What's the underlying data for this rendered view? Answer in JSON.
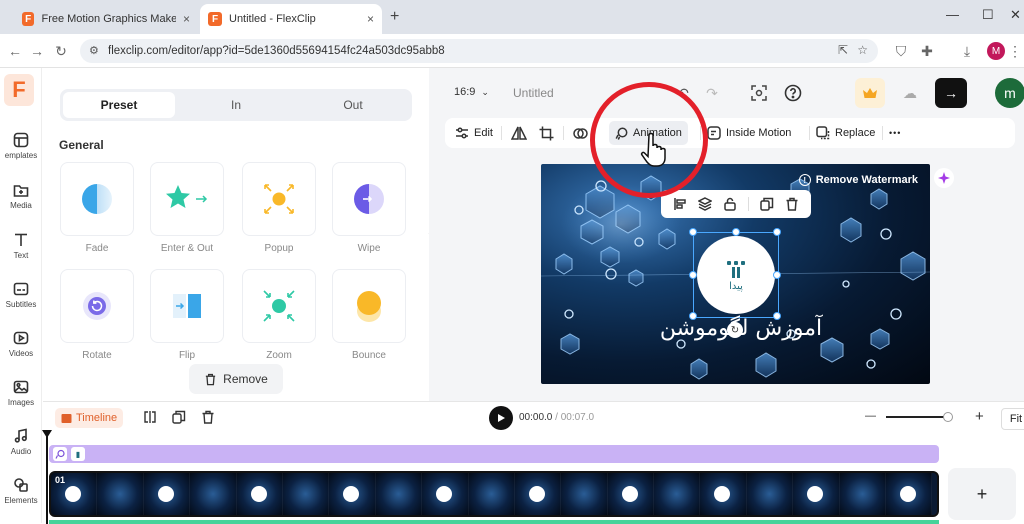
{
  "browser": {
    "tabs": [
      {
        "title": "Free Motion Graphics Maker O",
        "favicon": "F",
        "close": "×"
      },
      {
        "title": "Untitled - FlexClip",
        "favicon": "F",
        "close": "×"
      }
    ],
    "new_tab": "+",
    "url": "flexclip.com/editor/app?id=5de1360d55694154fc24a503dc95abb8",
    "profile_initial": "M",
    "window_controls": {
      "minimize": "—",
      "restore": "☐",
      "close": "✕"
    }
  },
  "rail": {
    "logo": "F",
    "items": [
      {
        "label": "emplates",
        "icon": "templates-icon"
      },
      {
        "label": "Media",
        "icon": "media-icon"
      },
      {
        "label": "Text",
        "icon": "text-icon"
      },
      {
        "label": "Subtitles",
        "icon": "subtitles-icon"
      },
      {
        "label": "Videos",
        "icon": "videos-icon"
      },
      {
        "label": "Images",
        "icon": "images-icon"
      },
      {
        "label": "Audio",
        "icon": "audio-icon"
      },
      {
        "label": "Elements",
        "icon": "elements-icon"
      }
    ]
  },
  "panel": {
    "tabs": [
      "Preset",
      "In",
      "Out"
    ],
    "active_tab": "Preset",
    "section_title": "General",
    "presets": [
      "Fade",
      "Enter & Out",
      "Popup",
      "Wipe",
      "Rotate",
      "Flip",
      "Zoom",
      "Bounce"
    ],
    "remove_label": "Remove"
  },
  "editor": {
    "ratio": "16:9",
    "title": "Untitled",
    "avatar_initial": "m",
    "export_icon": "→",
    "toolbar": {
      "edit": "Edit",
      "animation": "Animation",
      "inside_motion": "Inside Motion",
      "replace": "Replace",
      "more": "•••"
    },
    "canvas": {
      "watermark": "Remove Watermark",
      "logo_text": "پیدا",
      "title_text": "آموزش لگوموشن"
    }
  },
  "timeline": {
    "label": "Timeline",
    "current_time": "00:00.0",
    "separator": "/",
    "total_time": "00:07.0",
    "zoom_minus": "—",
    "zoom_plus": "+",
    "fit": "Fit",
    "clip_number": "01",
    "add_label": "+"
  },
  "colors": {
    "brand_orange": "#f26a2a",
    "annotation_red": "#e3202a",
    "overlay_track": "#c9b2f5",
    "selection_blue": "#4aa8ff",
    "avatar_green": "#1d6b3a"
  }
}
